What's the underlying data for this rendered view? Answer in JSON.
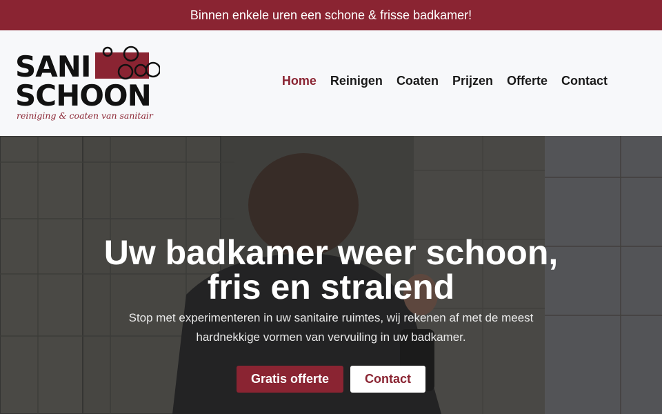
{
  "topbar": {
    "text": "Binnen enkele uren een schone & frisse badkamer!"
  },
  "logo": {
    "line1": "SANI",
    "line2": "SCHOON",
    "tagline": "reiniging & coaten van sanitair"
  },
  "nav": {
    "items": [
      {
        "label": "Home",
        "active": true
      },
      {
        "label": "Reinigen"
      },
      {
        "label": "Coaten"
      },
      {
        "label": "Prijzen"
      },
      {
        "label": "Offerte"
      },
      {
        "label": "Contact"
      }
    ]
  },
  "hero": {
    "title_line1": "Uw badkamer weer schoon,",
    "title_line2": "fris en stralend",
    "subtitle_line1": "Stop met experimenteren in uw sanitaire ruimtes, wij rekenen af met de meest",
    "subtitle_line2": "hardnekkige vormen van vervuiling in uw badkamer.",
    "primary_button": "Gratis offerte",
    "secondary_button": "Contact"
  },
  "colors": {
    "brand": "#8a2432",
    "text": "#1a1a1a"
  }
}
